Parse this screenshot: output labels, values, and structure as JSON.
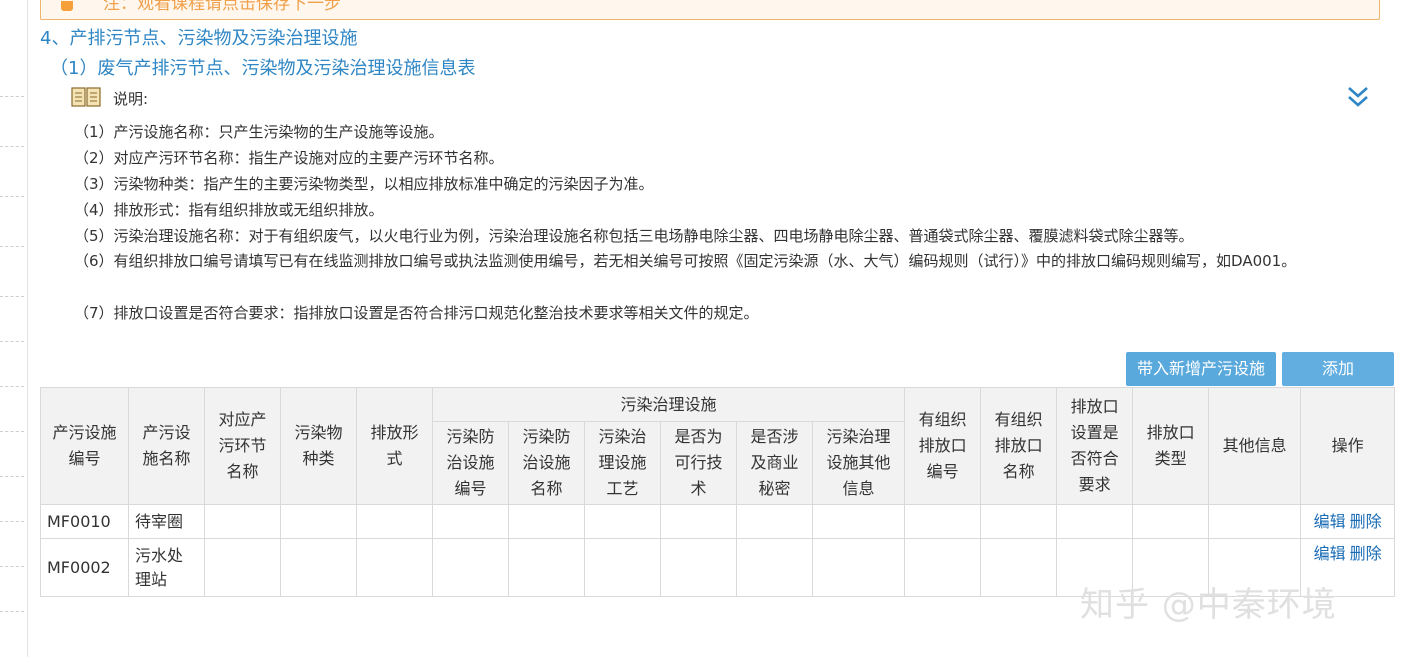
{
  "banner": {
    "text": "注：观看课程请点击保存下一步"
  },
  "section": {
    "title": "4、产排污节点、污染物及污染治理设施",
    "subtitle": "（1）废气产排污节点、污染物及污染治理设施信息表"
  },
  "notes": {
    "label": "说明:",
    "items": [
      "（1）产污设施名称：只产生污染物的生产设施等设施。",
      "（2）对应产污环节名称：指生产设施对应的主要产污环节名称。",
      "（3）污染物种类：指产生的主要污染物类型，以相应排放标准中确定的污染因子为准。",
      "（4）排放形式：指有组织排放或无组织排放。",
      "（5）污染治理设施名称：对于有组织废气，以火电行业为例，污染治理设施名称包括三电场静电除尘器、四电场静电除尘器、普通袋式除尘器、覆膜滤料袋式除尘器等。",
      "（6）有组织排放口编号请填写已有在线监测排放口编号或执法监测使用编号，若无相关编号可按照《固定污染源（水、大气）编码规则（试行）》中的排放口编码规则编写，如DA001。",
      "（7）排放口设置是否符合要求：指排放口设置是否符合排污口规范化整治技术要求等相关文件的规定。"
    ]
  },
  "toolbar": {
    "import_label": "带入新增产污设施",
    "add_label": "添加"
  },
  "table": {
    "headers": {
      "facility_code": "产污设施编号",
      "facility_name": "产污设施名称",
      "link_name": "对应产污环节名称",
      "pollutant": "污染物种类",
      "emission_form": "排放形式",
      "treatment_group": "污染治理设施",
      "treatment_code": "污染防治设施编号",
      "treatment_name": "污染防治设施名称",
      "treatment_process": "污染治理设施工艺",
      "feasible": "是否为可行技术",
      "secret": "是否涉及商业秘密",
      "treatment_other": "污染治理设施其他信息",
      "outlet_code": "有组织排放口编号",
      "outlet_name": "有组织排放口名称",
      "outlet_compliant": "排放口设置是否符合要求",
      "outlet_type": "排放口类型",
      "other_info": "其他信息",
      "actions": "操作"
    },
    "rows": [
      {
        "code": "MF0010",
        "name": "待宰圈",
        "edit": "编辑",
        "delete": "删除"
      },
      {
        "code": "MF0002",
        "name": "污水处理站",
        "edit": "编辑",
        "delete": "删除"
      }
    ]
  },
  "watermark": "知乎 @中秦环境",
  "colors": {
    "accent_blue": "#2f86c4",
    "button_blue": "#5aa9dc",
    "link_blue": "#1a6cb5",
    "banner_orange": "#f0a04a"
  }
}
